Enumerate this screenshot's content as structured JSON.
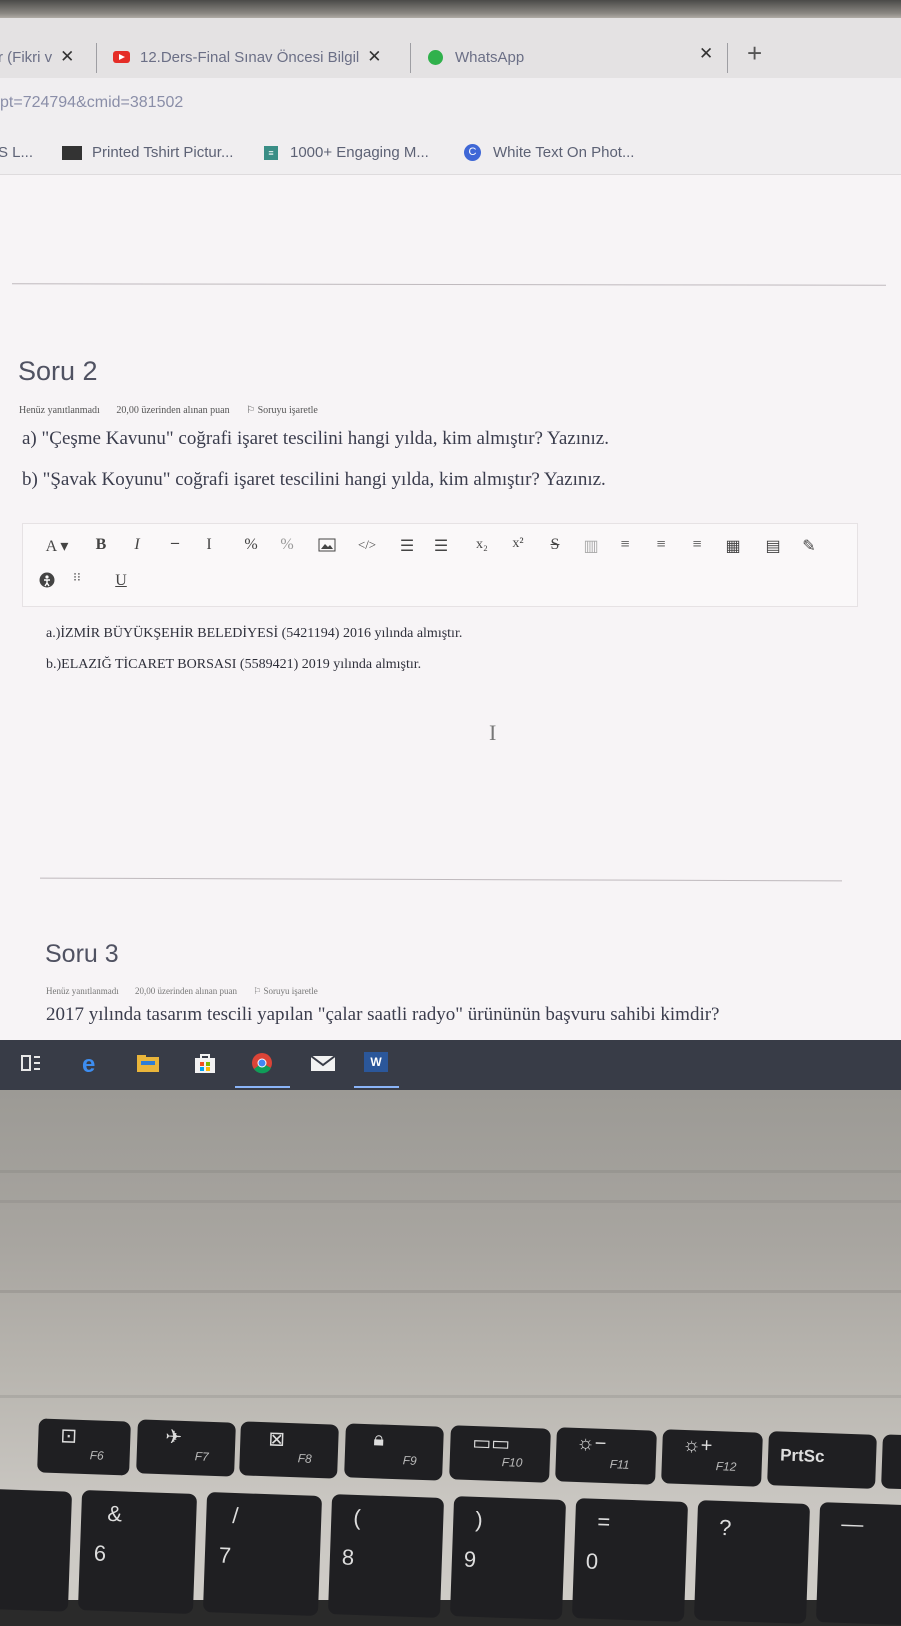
{
  "browser": {
    "tabs": [
      {
        "label": "r (Fikri v"
      },
      {
        "label": "12.Ders-Final Sınav Öncesi Bilgil"
      },
      {
        "label": "WhatsApp"
      }
    ],
    "tab_close": "✕",
    "new_tab": "+",
    "address": "pt=724794&cmid=381502",
    "bookmarks": [
      {
        "label": "S L..."
      },
      {
        "label": "Printed Tshirt Pictur..."
      },
      {
        "label": "1000+ Engaging M..."
      },
      {
        "label": "White Text On Phot..."
      }
    ]
  },
  "question2": {
    "title": "Soru 2",
    "status": "Henüz yanıtlanmadı",
    "points": "20,00 üzerinden alınan puan",
    "flag": "Soruyu işaretle",
    "line_a": "a) \"Çeşme Kavunu\" coğrafi işaret tescilini hangi yılda, kim almıştır? Yazınız.",
    "line_b": "b) \"Şavak Koyunu\" coğrafi işaret tescilini hangi yılda, kim almıştır? Yazınız.",
    "answer_a": "a.)İZMİR BÜYÜKŞEHİR BELEDİYESİ (5421194) 2016 yılında almıştır.",
    "answer_b": "b.)ELAZIĞ TİCARET BORSASI (5589421) 2019 yılında almıştır."
  },
  "editor_toolbar": {
    "font": "A ▾",
    "bold": "B",
    "italic": "I",
    "hr": "–",
    "clear": "I",
    "sub": "x₂",
    "sup": "x²",
    "strike": "S",
    "underline": "U",
    "icons": [
      "link-icon",
      "unlink-icon",
      "image-icon",
      "code-icon",
      "bullet-list-icon",
      "numbered-list-icon",
      "table-icon",
      "align-left-icon",
      "align-center-icon",
      "align-right-icon",
      "grid-icon",
      "calculator-icon",
      "edit-icon",
      "accessibility-icon",
      "special-chars-icon"
    ]
  },
  "question3": {
    "title": "Soru 3",
    "status": "Henüz yanıtlanmadı",
    "points": "20,00 üzerinden alınan puan",
    "flag": "Soruyu işaretle",
    "text": "2017 yılında tasarım tescili yapılan \"çalar saatli radyo\" ürününün başvuru sahibi kimdir?"
  },
  "taskbar": {
    "icons": [
      "task-view-icon",
      "edge-icon",
      "file-explorer-icon",
      "store-icon",
      "chrome-icon",
      "mail-icon",
      "word-icon"
    ],
    "word_label": "W"
  },
  "keyboard": {
    "fkeys": [
      "F6",
      "F7",
      "F8",
      "F9",
      "F10",
      "F11",
      "F12",
      "PrtSc"
    ],
    "numkeys": [
      {
        "top": "&",
        "bottom": "6"
      },
      {
        "top": "/",
        "bottom": "7"
      },
      {
        "top": "(",
        "bottom": "8"
      },
      {
        "top": ")",
        "bottom": "9"
      },
      {
        "top": "=",
        "bottom": "0"
      },
      {
        "top": "?",
        "bottom": ""
      },
      {
        "top": "—",
        "bottom": ""
      }
    ]
  }
}
